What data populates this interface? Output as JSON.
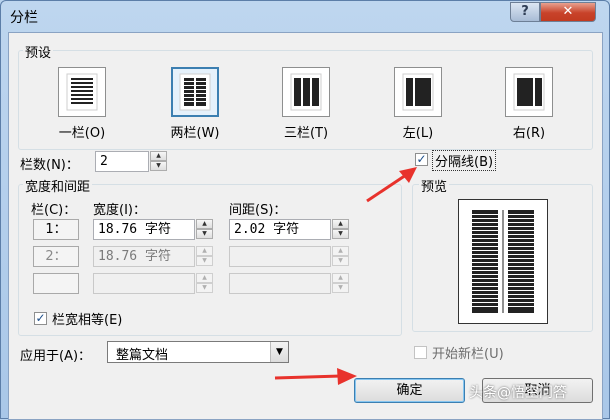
{
  "window": {
    "title": "分栏",
    "help_label": "?",
    "close_label": "✕"
  },
  "presets": {
    "group_label": "预设",
    "items": [
      {
        "label": "一栏(O)"
      },
      {
        "label": "两栏(W)"
      },
      {
        "label": "三栏(T)"
      },
      {
        "label": "左(L)"
      },
      {
        "label": "右(R)"
      }
    ]
  },
  "columns_count": {
    "label": "栏数(N)：",
    "value": "2"
  },
  "separator": {
    "label": "分隔线(B)",
    "checked": true
  },
  "width_spacing": {
    "group_label": "宽度和间距",
    "col_header": "栏(C)：",
    "width_header": "宽度(I)：",
    "spacing_header": "间距(S)：",
    "rows": [
      {
        "num": "1：",
        "width": "18.76 字符",
        "spacing": "2.02 字符"
      },
      {
        "num": "2：",
        "width": "18.76 字符",
        "spacing": ""
      },
      {
        "num": "",
        "width": "",
        "spacing": ""
      }
    ]
  },
  "equal_width": {
    "label": "栏宽相等(E)",
    "checked": true
  },
  "preview": {
    "label": "预览"
  },
  "apply_to": {
    "label": "应用于(A)：",
    "value": "整篇文档"
  },
  "new_column": {
    "label": "开始新栏(U)",
    "checked": false
  },
  "buttons": {
    "ok": "确定",
    "cancel": "取消"
  },
  "watermark": "头条@悟空问答"
}
